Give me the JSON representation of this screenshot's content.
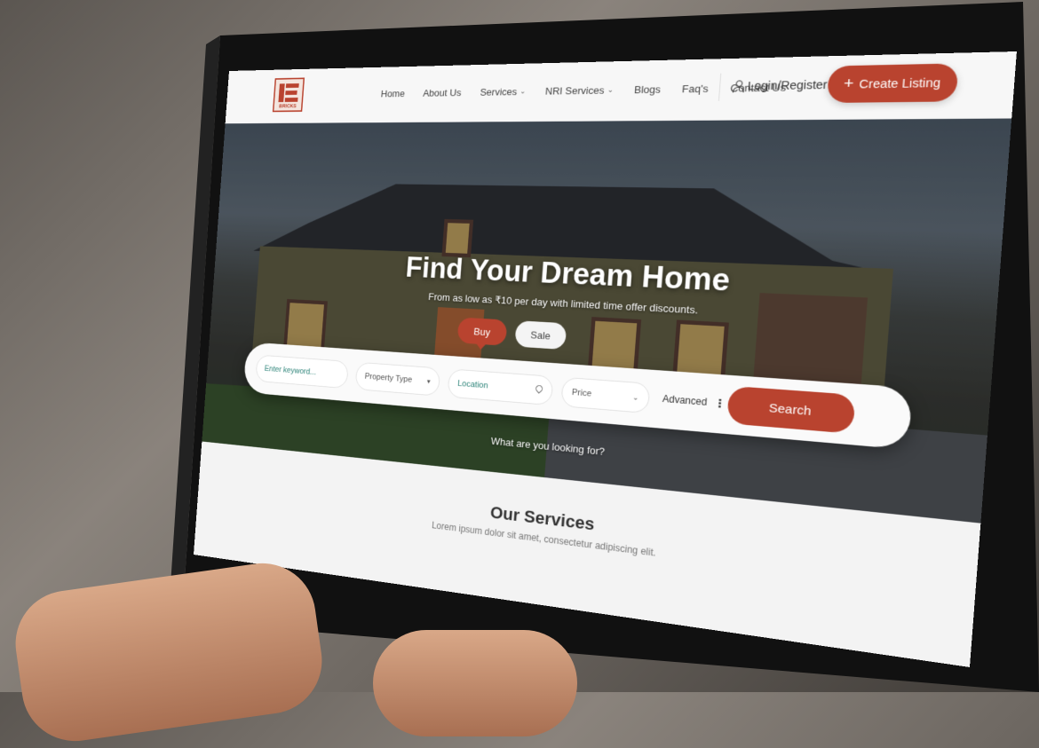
{
  "nav": {
    "logo_text": "BRICKS",
    "items": [
      {
        "label": "Home",
        "dropdown": false
      },
      {
        "label": "About Us",
        "dropdown": false
      },
      {
        "label": "Services",
        "dropdown": true
      },
      {
        "label": "NRI Services",
        "dropdown": true
      },
      {
        "label": "Blogs",
        "dropdown": false
      },
      {
        "label": "Faq's",
        "dropdown": false
      },
      {
        "label": "Contact Us",
        "dropdown": false
      }
    ],
    "login_label": "Login/Register",
    "cta_label": "Create Listing"
  },
  "hero": {
    "title": "Find Your Dream Home",
    "subtitle": "From as low as ₹10 per day with limited time offer discounts.",
    "tabs": {
      "buy": "Buy",
      "sale": "Sale"
    },
    "search": {
      "keyword_placeholder": "Enter keyword...",
      "property_type": "Property Type",
      "location": "Location",
      "price": "Price",
      "advanced": "Advanced",
      "button": "Search"
    },
    "prompt": "What are you looking for?"
  },
  "services": {
    "title": "Our Services",
    "subtitle": "Lorem ipsum dolor sit amet, consectetur adipiscing elit."
  },
  "colors": {
    "accent": "#b9432f",
    "link_teal": "#2d8479"
  }
}
